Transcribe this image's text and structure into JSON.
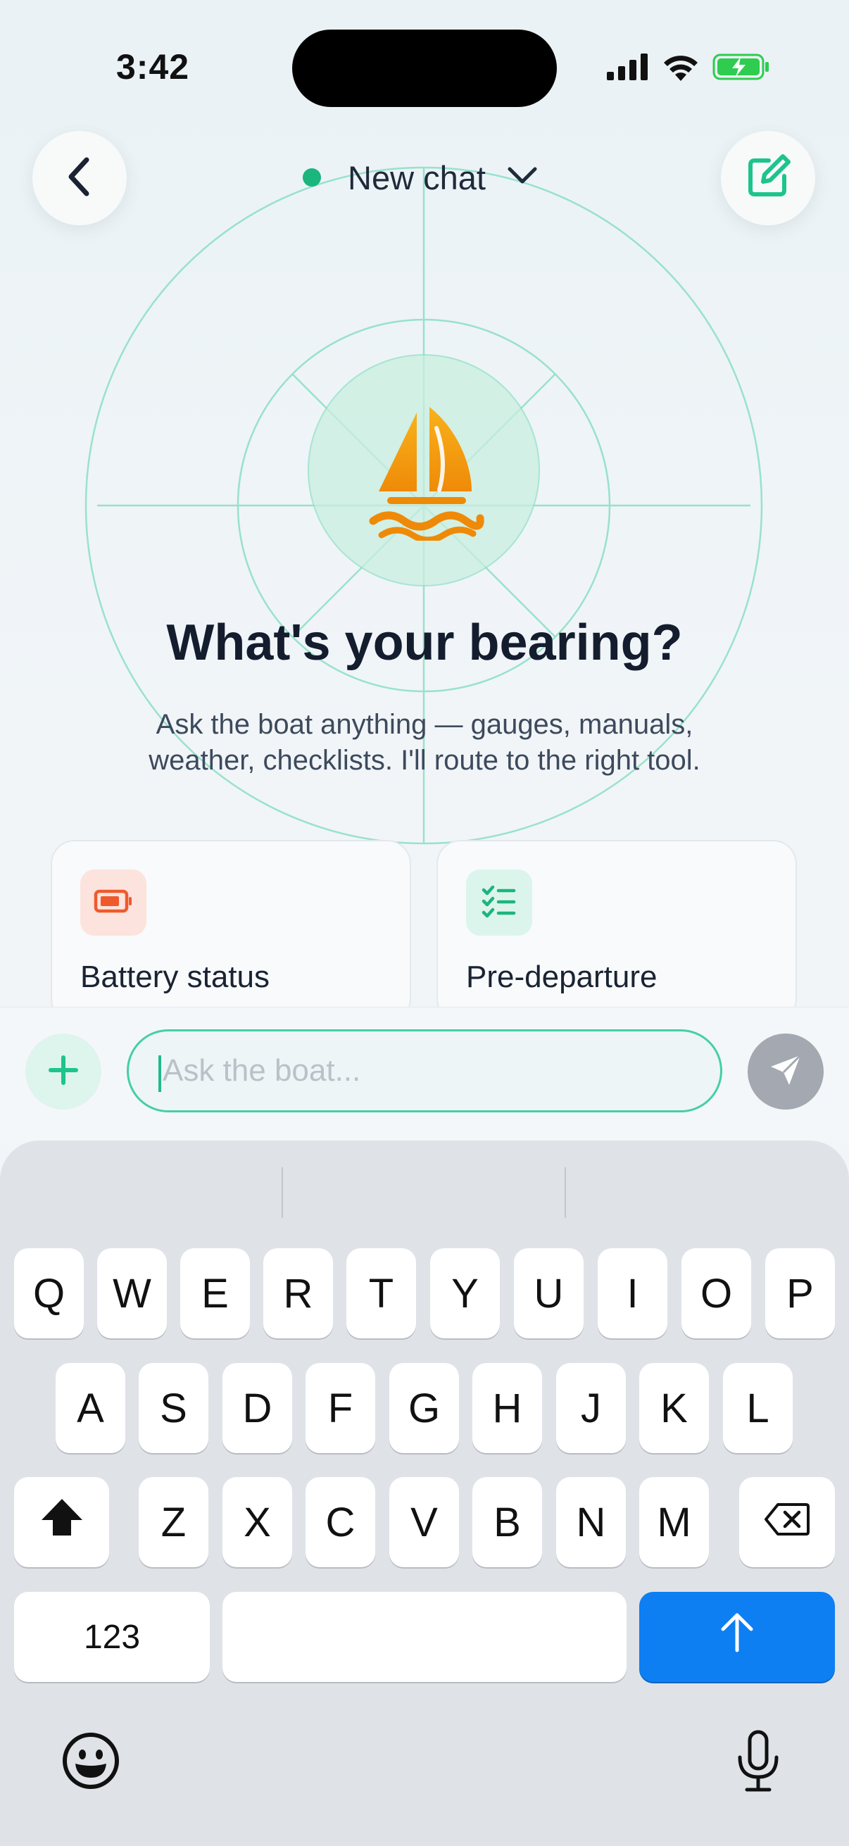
{
  "status_bar": {
    "time": "3:42",
    "icons": [
      "signal-icon",
      "wifi-icon",
      "battery-charging-icon"
    ]
  },
  "header": {
    "title": "New chat",
    "status_dot_color": "#1bb57e",
    "back_icon": "chevron-left-icon",
    "compose_icon": "compose-icon"
  },
  "hero": {
    "icon": "sailboat-icon",
    "title": "What's your bearing?",
    "subtitle_line1": "Ask the boat anything — gauges, manuals,",
    "subtitle_line2": "weather, checklists. I'll route to the right tool."
  },
  "suggestions": [
    {
      "label": "Battery status",
      "icon": "battery-icon",
      "tile_color": "#fde3dd",
      "icon_color": "#ef5a2c"
    },
    {
      "label": "Pre-departure",
      "icon": "checklist-icon",
      "tile_color": "#dcf5ec",
      "icon_color": "#1bb57e"
    }
  ],
  "composer": {
    "placeholder": "Ask the boat...",
    "value": "",
    "attach_icon": "plus-icon",
    "send_icon": "send-icon"
  },
  "keyboard": {
    "row1": [
      "Q",
      "W",
      "E",
      "R",
      "T",
      "Y",
      "U",
      "I",
      "O",
      "P"
    ],
    "row2": [
      "A",
      "S",
      "D",
      "F",
      "G",
      "H",
      "J",
      "K",
      "L"
    ],
    "row3": [
      "Z",
      "X",
      "C",
      "V",
      "B",
      "N",
      "M"
    ],
    "numbers_label": "123",
    "space_label": "",
    "shift_icon": "shift-icon",
    "delete_icon": "delete-icon",
    "return_icon": "arrow-up-icon",
    "emoji_icon": "emoji-icon",
    "mic_icon": "microphone-icon"
  },
  "colors": {
    "accent": "#1bb57e",
    "radar_line": "#8fe0c7",
    "boat": "#f59a12",
    "return_key": "#0d7ff2"
  }
}
